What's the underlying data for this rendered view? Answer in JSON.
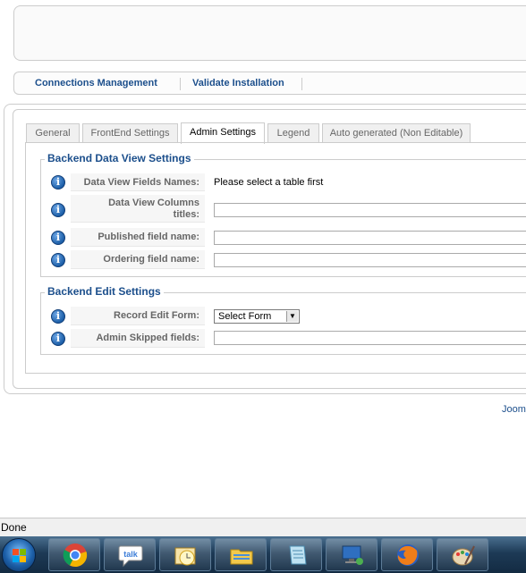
{
  "nav": {
    "links": [
      "Connections Management",
      "Validate Installation"
    ]
  },
  "tabs": [
    {
      "label": "General",
      "active": false
    },
    {
      "label": "FrontEnd Settings",
      "active": false
    },
    {
      "label": "Admin Settings",
      "active": true
    },
    {
      "label": "Legend",
      "active": false
    },
    {
      "label": "Auto generated (Non Editable)",
      "active": false
    }
  ],
  "backend_data_view": {
    "legend": "Backend Data View Settings",
    "fields": [
      {
        "label": "Data View Fields Names:",
        "value": "Please select a table first",
        "type": "text"
      },
      {
        "label_line1": "Data View Columns",
        "label_line2": "titles:",
        "value": "",
        "type": "input"
      },
      {
        "label": "Published field name:",
        "value": "",
        "type": "input"
      },
      {
        "label": "Ordering field name:",
        "value": "",
        "type": "input"
      }
    ]
  },
  "backend_edit": {
    "legend": "Backend Edit Settings",
    "fields": [
      {
        "label": "Record Edit Form:",
        "value": "Select Form",
        "type": "select"
      },
      {
        "label": "Admin Skipped fields:",
        "value": "",
        "type": "input"
      }
    ]
  },
  "footer_link": "Jooml",
  "status_bar": "Done",
  "taskbar": {
    "apps": [
      "chrome-icon",
      "gtalk-icon",
      "outlook-calendar-icon",
      "folder-icon",
      "notepad-icon",
      "remote-desktop-icon",
      "firefox-icon",
      "paint-icon"
    ]
  },
  "colors": {
    "accent": "#1c4f8c",
    "info_icon": "#1d5fa8"
  }
}
